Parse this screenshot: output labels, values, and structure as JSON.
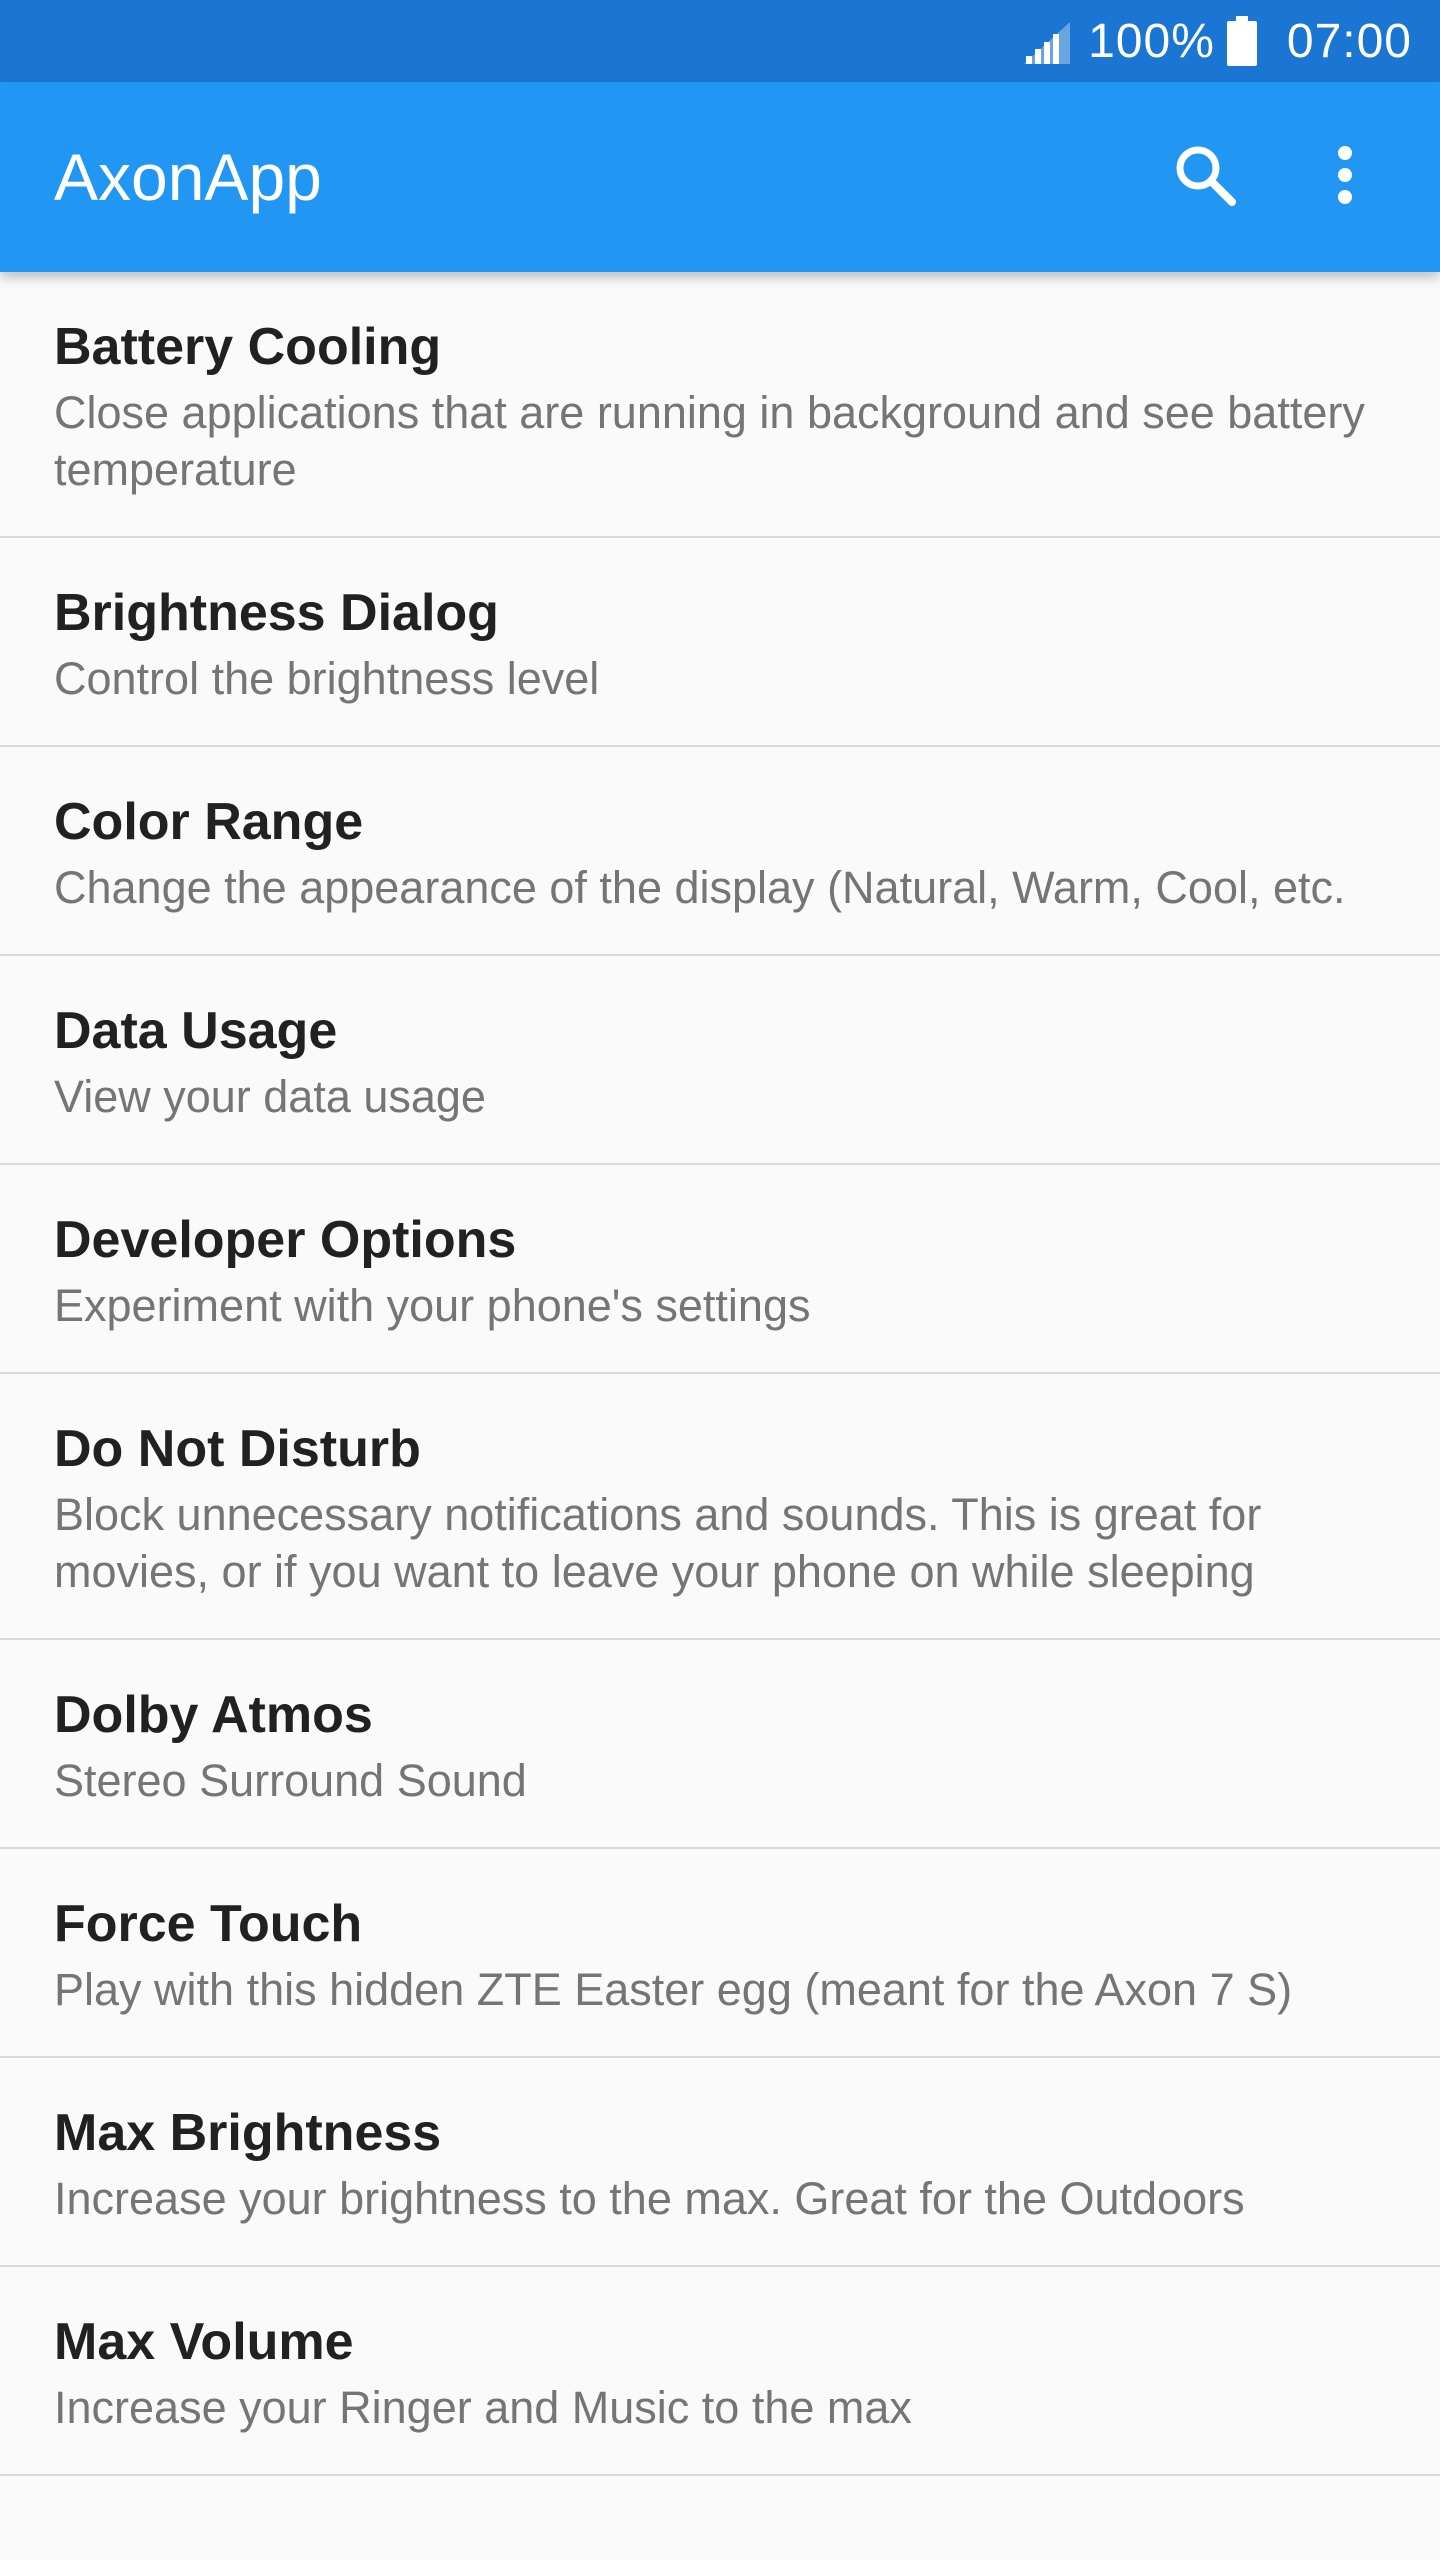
{
  "status_bar": {
    "battery_percent": "100%",
    "time": "07:00"
  },
  "app_bar": {
    "title": "AxonApp",
    "search_icon": "search-icon",
    "overflow_icon": "more-vert-icon",
    "colors": {
      "status_bar": "#1a76d2",
      "app_bar": "#2196f3"
    }
  },
  "list": {
    "items": [
      {
        "title": "Battery Cooling",
        "summary": "Close applications that are running in background and see battery temperature"
      },
      {
        "title": "Brightness Dialog",
        "summary": "Control the brightness level"
      },
      {
        "title": "Color Range",
        "summary": "Change the appearance of the display (Natural, Warm, Cool, etc."
      },
      {
        "title": "Data Usage",
        "summary": "View your data usage"
      },
      {
        "title": "Developer Options",
        "summary": "Experiment with your phone's settings"
      },
      {
        "title": "Do Not Disturb",
        "summary": "Block unnecessary notifications and sounds. This is great for movies, or if you want to leave your phone on while sleeping"
      },
      {
        "title": "Dolby Atmos",
        "summary": "Stereo Surround Sound"
      },
      {
        "title": "Force Touch",
        "summary": "Play with this hidden ZTE Easter egg (meant for the Axon 7 S)"
      },
      {
        "title": "Max Brightness",
        "summary": "Increase your brightness to the max. Great for the Outdoors"
      },
      {
        "title": "Max Volume",
        "summary": "Increase your Ringer and Music to the max"
      }
    ]
  }
}
